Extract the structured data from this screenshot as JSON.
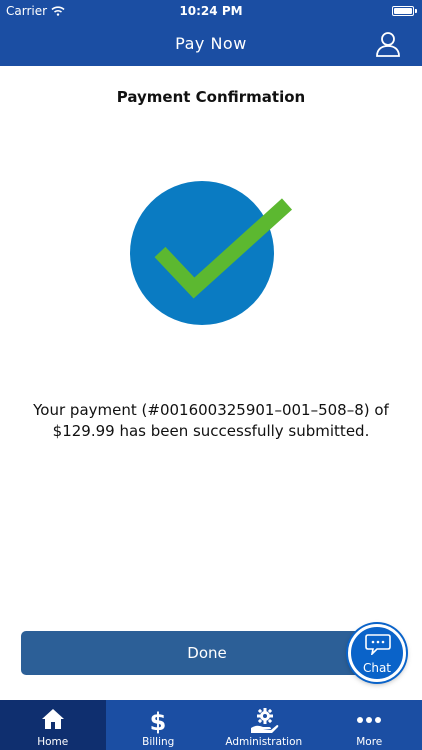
{
  "status_bar": {
    "carrier": "Carrier",
    "time": "10:24 PM"
  },
  "nav": {
    "title": "Pay Now",
    "profile_icon": "user-icon"
  },
  "content": {
    "title": "Payment Confirmation",
    "message": "Your payment (#001600325901–001–508–8) of $129.99 has been successfully submitted."
  },
  "done_label": "Done",
  "chat": {
    "label": "Chat",
    "icon": "chat-bubble-icon"
  },
  "tabs": [
    {
      "label": "Home",
      "icon": "home-icon",
      "active": true
    },
    {
      "label": "Billing",
      "icon": "dollar-icon",
      "active": false
    },
    {
      "label": "Administration",
      "icon": "gear-hand-icon",
      "active": false
    },
    {
      "label": "More",
      "icon": "more-dots-icon",
      "active": false
    }
  ],
  "colors": {
    "brand": "#1b4ea3",
    "tab_active": "#0f2f6f",
    "button": "#2c5f97",
    "success_circle": "#0a7bc2",
    "check": "#5cb830"
  }
}
